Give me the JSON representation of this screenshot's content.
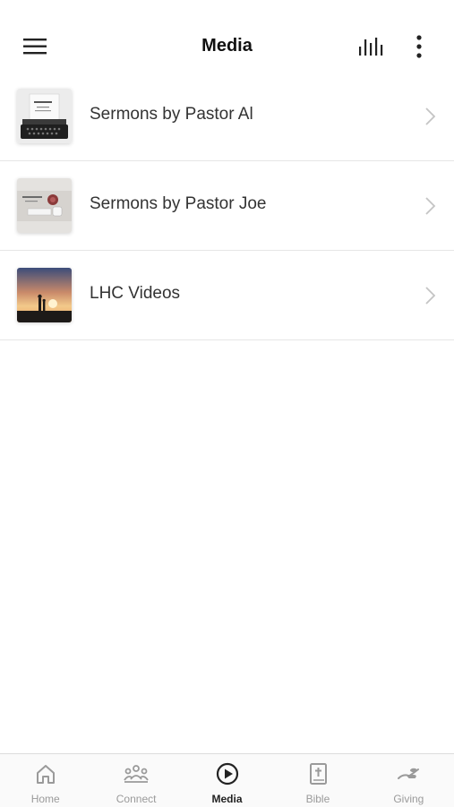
{
  "header": {
    "title": "Media",
    "menu_icon": "hamburger-menu-icon",
    "bars_icon": "audio-bars-icon",
    "more_icon": "vertical-ellipsis-icon"
  },
  "media_items": [
    {
      "label": "Sermons by Pastor Al",
      "thumbnail": "typewriter-photo"
    },
    {
      "label": "Sermons by Pastor Joe",
      "thumbnail": "desk-photo"
    },
    {
      "label": "LHC Videos",
      "thumbnail": "sunset-silhouette-photo"
    }
  ],
  "tabs": [
    {
      "label": "Home",
      "icon": "house-icon"
    },
    {
      "label": "Connect",
      "icon": "people-group-icon"
    },
    {
      "label": "Media",
      "icon": "play-circle-icon",
      "active": true
    },
    {
      "label": "Bible",
      "icon": "bible-cross-icon"
    },
    {
      "label": "Giving",
      "icon": "giving-hand-icon"
    }
  ],
  "colors": {
    "active_tab": "#222222",
    "inactive_tab": "#9a9a9a",
    "divider": "#e6e6e6"
  }
}
